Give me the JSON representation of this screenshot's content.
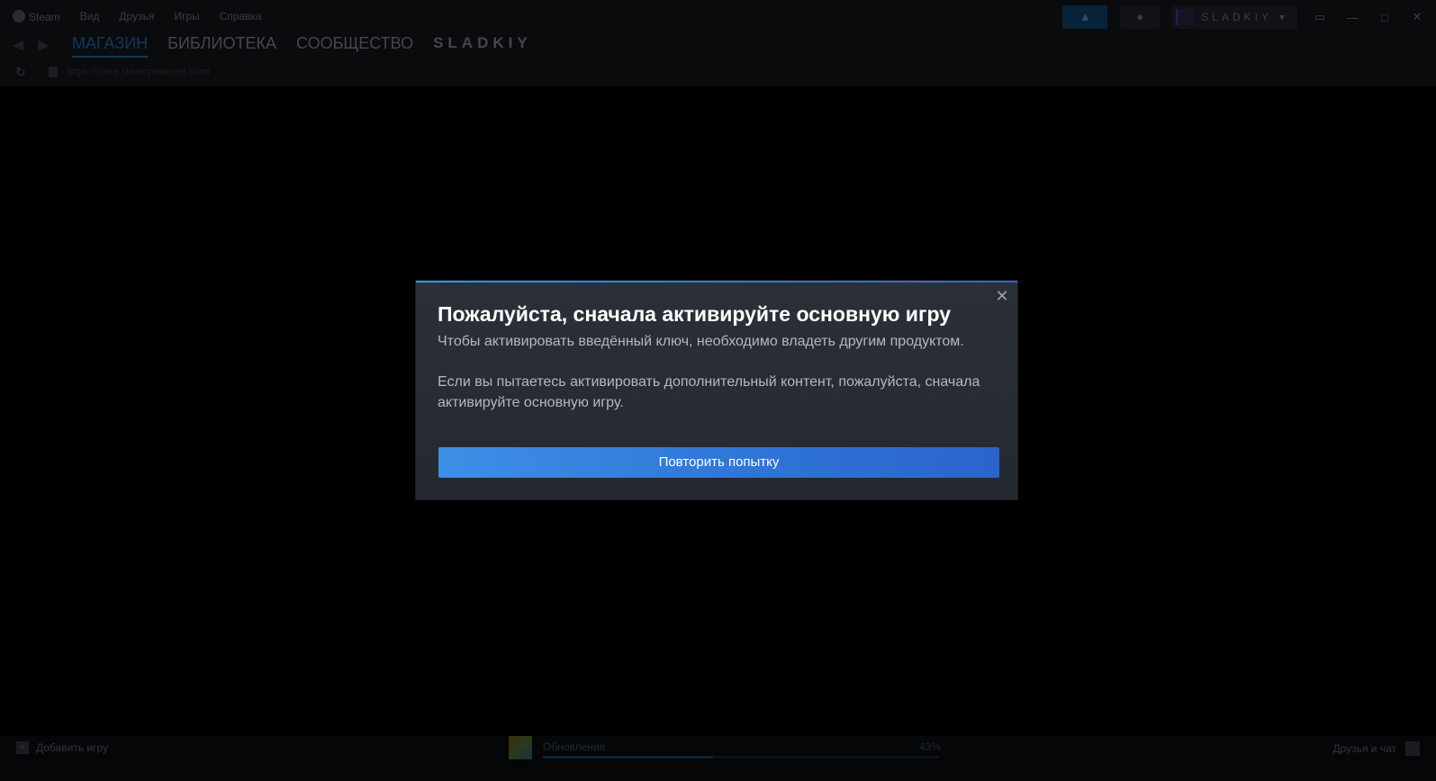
{
  "menubar": {
    "items": [
      "Steam",
      "Вид",
      "Друзья",
      "Игры",
      "Справка"
    ],
    "username": "SLADKIY",
    "announce_icon": "megaphone-icon",
    "bell_icon": "bell-icon"
  },
  "nav": {
    "tabs": [
      "МАГАЗИН",
      "БИБЛИОТЕКА",
      "СООБЩЕСТВО",
      "SLADKIY"
    ],
    "active_tab": 0
  },
  "url": {
    "text": "https://store.steampowered.com/"
  },
  "dialog": {
    "title": "Пожалуйста, сначала активируйте основную игру",
    "text1": "Чтобы активировать введённый ключ, необходимо владеть другим продуктом.",
    "text2": "Если вы пытаетесь активировать дополнительный контент, пожалуйста, сначала активируйте основную игру.",
    "retry_label": "Повторить попытку",
    "close_glyph": "✕",
    "accent_color": "#1a9fff",
    "button_color": "#3a87e0"
  },
  "bottombar": {
    "add_game": "Добавить игру",
    "update_label": "Обновление",
    "update_percent": "43%",
    "update_progress": 0.43,
    "friends_chat": "Друзья и чат"
  }
}
